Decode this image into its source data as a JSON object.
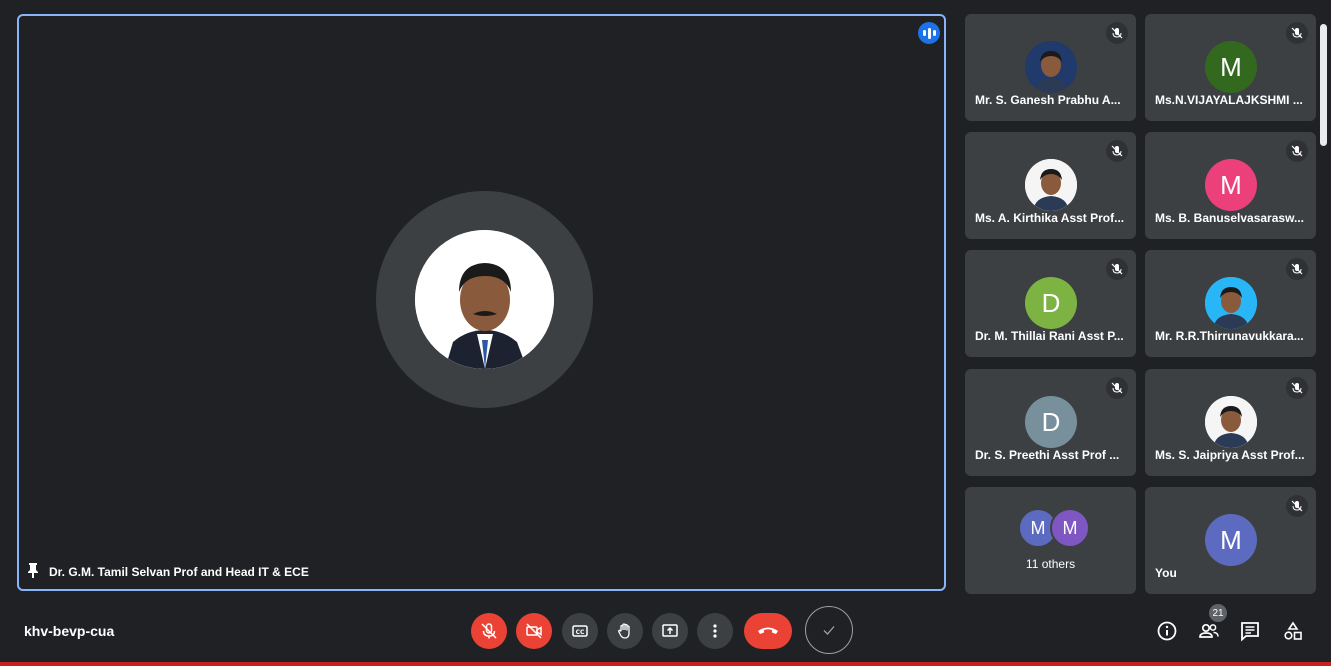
{
  "main_speaker": {
    "name": "Dr. G.M. Tamil Selvan Prof and Head IT & ECE"
  },
  "participants": [
    {
      "name": "Mr. S. Ganesh Prabhu A...",
      "initial": "",
      "avatar_color": "#1f3a6b",
      "photo": true
    },
    {
      "name": "Ms.N.VIJAYALAJKSHMI ...",
      "initial": "M",
      "avatar_color": "#33691e",
      "photo": false
    },
    {
      "name": "Ms. A. Kirthika Asst Prof...",
      "initial": "",
      "avatar_color": "#f5f5f5",
      "photo": true
    },
    {
      "name": "Ms. B. Banuselvasarasw...",
      "initial": "M",
      "avatar_color": "#ec407a",
      "photo": false
    },
    {
      "name": "Dr. M. Thillai Rani Asst P...",
      "initial": "D",
      "avatar_color": "#7cb342",
      "photo": false
    },
    {
      "name": "Mr. R.R.Thirrunavukkara...",
      "initial": "",
      "avatar_color": "#29b6f6",
      "photo": true
    },
    {
      "name": "Dr. S. Preethi Asst Prof ...",
      "initial": "D",
      "avatar_color": "#78909c",
      "photo": false
    },
    {
      "name": "Ms. S. Jaipriya Asst Prof...",
      "initial": "",
      "avatar_color": "#f5f5f5",
      "photo": true
    }
  ],
  "others_tile": {
    "label": "11 others",
    "avatars": [
      {
        "initial": "M",
        "color": "#5c6bc0"
      },
      {
        "initial": "M",
        "color": "#7e57c2"
      }
    ]
  },
  "self_tile": {
    "name": "You",
    "initial": "M",
    "avatar_color": "#5c6bc0"
  },
  "bottom_bar": {
    "meeting_code": "khv-bevp-cua",
    "participant_count": "21"
  },
  "controls": [
    {
      "icon": "mic-off-icon",
      "state": "off"
    },
    {
      "icon": "camera-off-icon",
      "state": "off"
    },
    {
      "icon": "captions-icon"
    },
    {
      "icon": "raise-hand-icon"
    },
    {
      "icon": "present-screen-icon"
    },
    {
      "icon": "more-options-icon"
    },
    {
      "icon": "hang-up-icon"
    },
    {
      "icon": "checkmark-icon"
    }
  ],
  "right_controls": [
    {
      "icon": "info-icon"
    },
    {
      "icon": "people-icon"
    },
    {
      "icon": "chat-icon"
    },
    {
      "icon": "activities-icon"
    }
  ],
  "colors": {
    "background": "#202124",
    "tile": "#3c4043",
    "active_border": "#8ab4f8",
    "danger": "#ea4335",
    "speaking": "#1a73e8"
  }
}
